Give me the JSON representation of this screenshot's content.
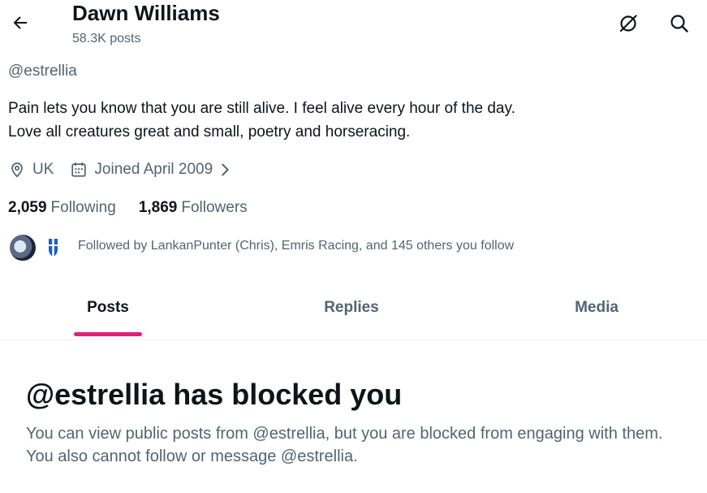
{
  "header": {
    "title": "Dawn Williams",
    "post_count": "58.3K posts"
  },
  "profile": {
    "handle": "@estrellia",
    "bio_line1": "Pain lets you know that you are still alive. I feel alive every hour of the day.",
    "bio_line2": "Love all creatures great and small, poetry and horseracing.",
    "location": "UK",
    "joined": "Joined April 2009",
    "following_count": "2,059",
    "following_label": "Following",
    "followers_count": "1,869",
    "followers_label": "Followers",
    "followed_by": "Followed by LankanPunter (Chris), Emris Racing, and 145 others you follow"
  },
  "tabs": [
    {
      "label": "Posts",
      "active": true
    },
    {
      "label": "Replies",
      "active": false
    },
    {
      "label": "Media",
      "active": false
    }
  ],
  "blocked": {
    "title": "@estrellia has blocked you",
    "message": "You can view public posts from @estrellia, but you are blocked from engaging with them. You also cannot follow or message @estrellia."
  },
  "icons": {
    "back": "arrow-left-icon",
    "grok": "grok-icon",
    "search": "search-icon",
    "location": "location-pin-icon",
    "calendar": "calendar-icon",
    "chevron": "chevron-right-icon"
  },
  "colors": {
    "accent": "#e0207c",
    "text_primary": "#0f1419",
    "text_secondary": "#536471",
    "divider": "#eff3f4"
  }
}
